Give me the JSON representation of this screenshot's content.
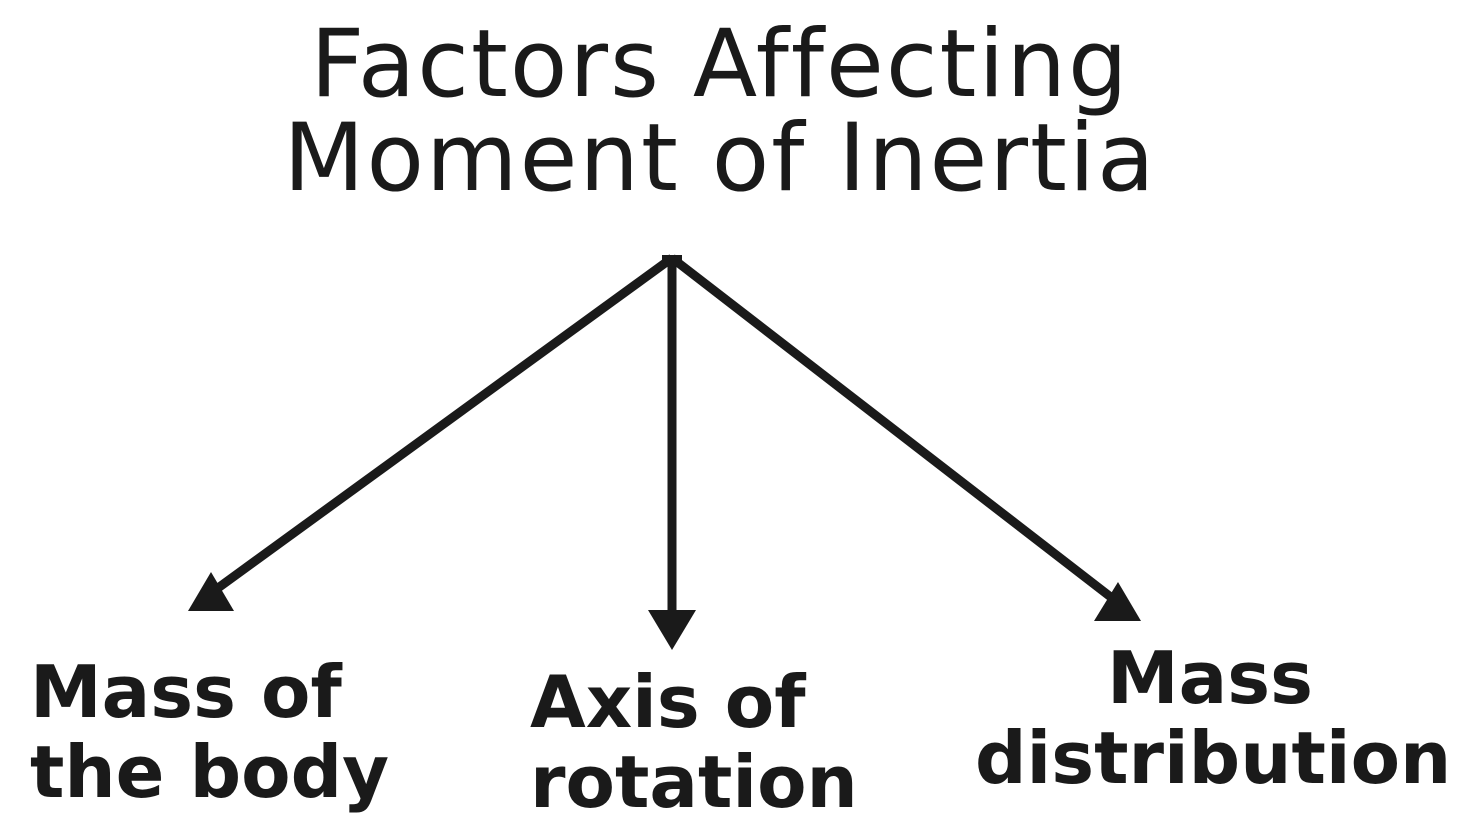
{
  "title": {
    "line1": "Factors Affecting",
    "line2": "Moment of Inertia"
  },
  "factors": [
    {
      "line1": "Mass of",
      "line2": "the body"
    },
    {
      "line1": "Axis of",
      "line2": "rotation"
    },
    {
      "line1": "Mass",
      "line2": "distribution"
    }
  ],
  "colors": {
    "ink": "#1a1a1a",
    "background": "#ffffff"
  }
}
